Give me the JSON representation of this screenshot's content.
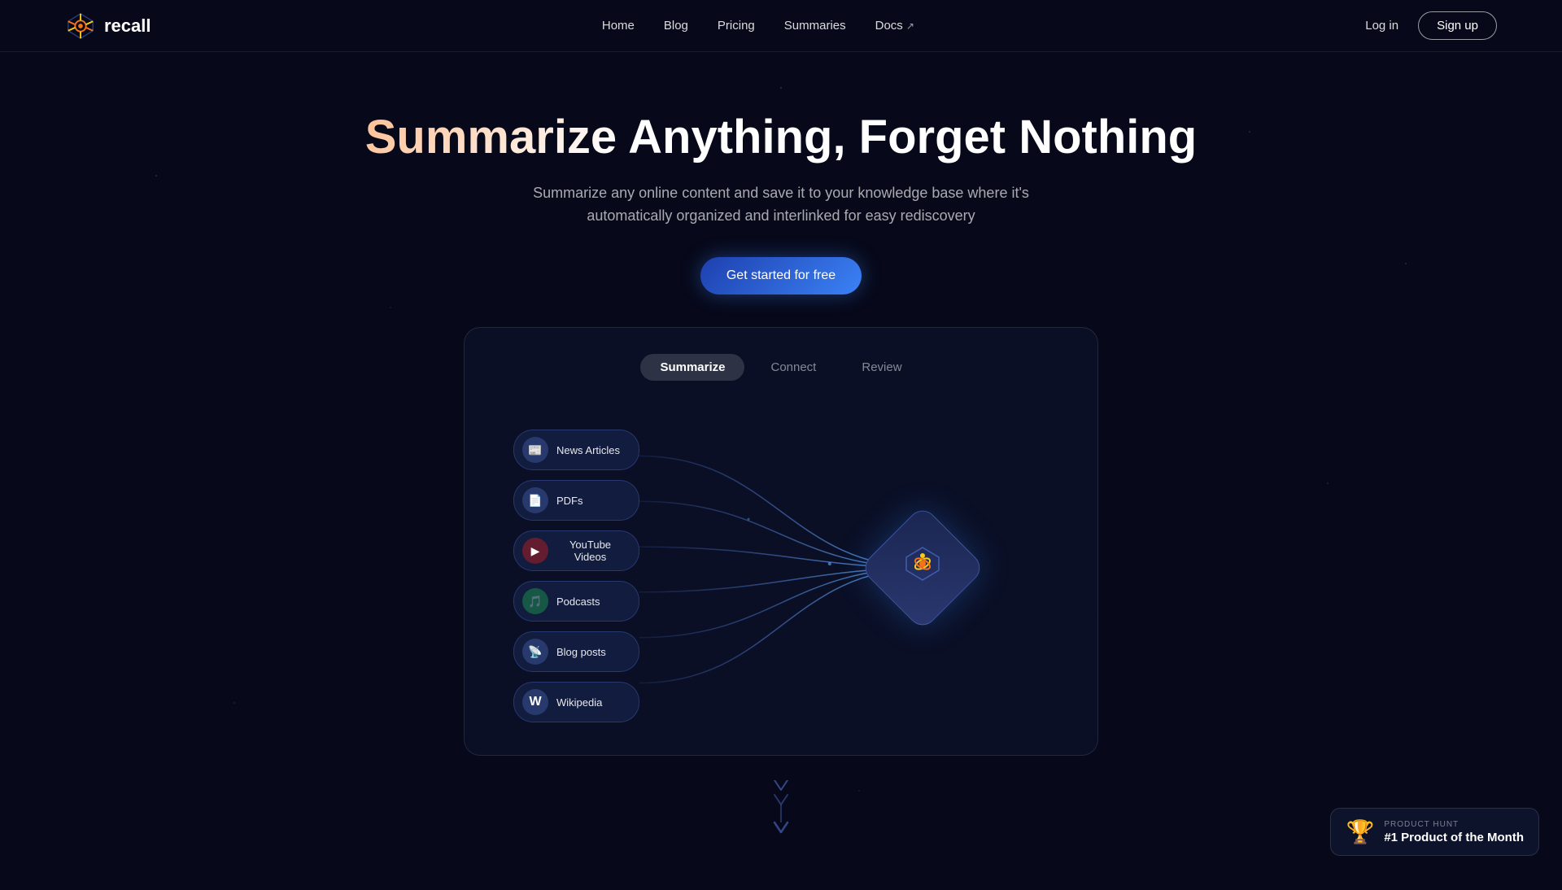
{
  "brand": {
    "name": "recall",
    "logo_icon": "🔆"
  },
  "nav": {
    "links": [
      {
        "label": "Home",
        "id": "home"
      },
      {
        "label": "Blog",
        "id": "blog"
      },
      {
        "label": "Pricing",
        "id": "pricing"
      },
      {
        "label": "Summaries",
        "id": "summaries"
      },
      {
        "label": "Docs",
        "id": "docs",
        "external": true
      }
    ],
    "login_label": "Log in",
    "signup_label": "Sign up"
  },
  "hero": {
    "title": "Summarize Anything, Forget Nothing",
    "subtitle": "Summarize any online content and save it to your knowledge base where it's automatically organized and interlinked for easy rediscovery",
    "cta_label": "Get started for free"
  },
  "tabs": [
    {
      "label": "Summarize",
      "active": true
    },
    {
      "label": "Connect",
      "active": false
    },
    {
      "label": "Review",
      "active": false
    }
  ],
  "diagram": {
    "nodes": [
      {
        "label": "News Articles",
        "icon": "📰",
        "id": "news"
      },
      {
        "label": "PDFs",
        "icon": "📄",
        "id": "pdfs"
      },
      {
        "label": "YouTube Videos",
        "icon": "▶",
        "id": "youtube"
      },
      {
        "label": "Podcasts",
        "icon": "🎵",
        "id": "podcasts"
      },
      {
        "label": "Blog posts",
        "icon": "📡",
        "id": "blogs"
      },
      {
        "label": "Wikipedia",
        "icon": "W",
        "id": "wikipedia"
      }
    ],
    "center_icon": "⚛"
  },
  "product_hunt": {
    "label": "PRODUCT HUNT",
    "badge_text": "#1 Product of the Month",
    "trophy": "🏆"
  }
}
